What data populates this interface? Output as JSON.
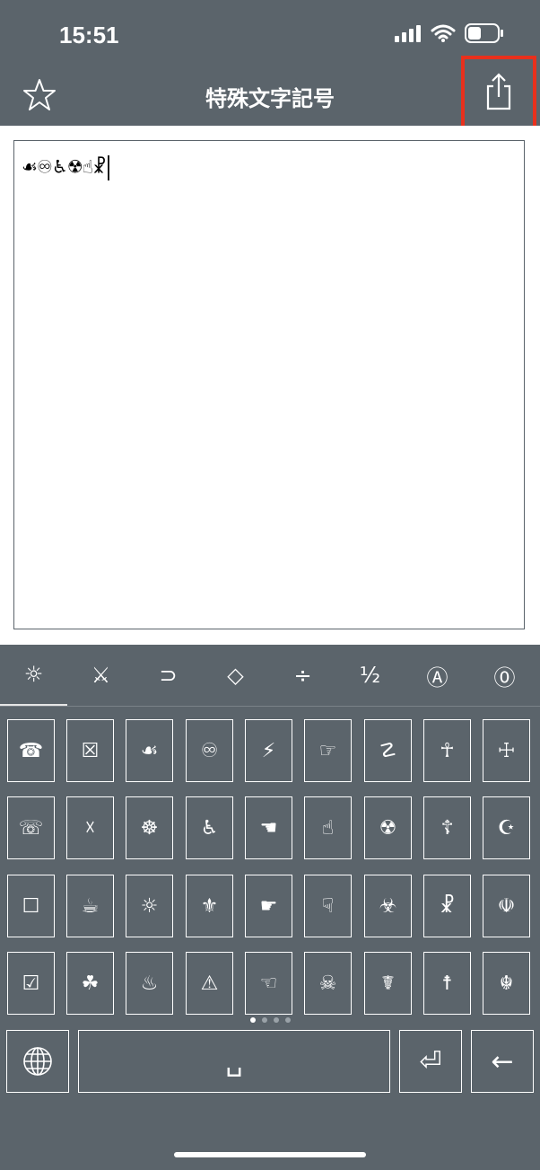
{
  "status_bar": {
    "time": "15:51"
  },
  "nav": {
    "title": "特殊文字記号",
    "star_icon": "star-outline-icon",
    "share_icon": "share-icon",
    "highlight_color": "#e8301c"
  },
  "editor": {
    "text": "☙♾♿☢☝☧"
  },
  "tabs": [
    {
      "symbol": "☼",
      "name": "tab-weather"
    },
    {
      "symbol": "⚔",
      "name": "tab-crossed-swords"
    },
    {
      "symbol": "⊃",
      "name": "tab-arrows"
    },
    {
      "symbol": "◇",
      "name": "tab-shapes"
    },
    {
      "symbol": "÷",
      "name": "tab-math"
    },
    {
      "symbol": "½",
      "name": "tab-fractions"
    },
    {
      "symbol": "Ⓐ",
      "name": "tab-circled-letters"
    },
    {
      "symbol": "⓪",
      "name": "tab-circled-numbers"
    }
  ],
  "keys": [
    [
      "☎",
      "☒",
      "☙",
      "♾",
      "⚡",
      "☞",
      "☡",
      "☥",
      "☩"
    ],
    [
      "☏",
      "☓",
      "☸",
      "♿",
      "☚",
      "☝",
      "☢",
      "☦",
      "☪"
    ],
    [
      "☐",
      "☕",
      "☼",
      "⚜",
      "☛",
      "☟",
      "☣",
      "☧",
      "☫"
    ],
    [
      "☑",
      "☘",
      "♨",
      "⚠",
      "☜",
      "☠",
      "☤",
      "☨",
      "☬"
    ]
  ],
  "page_indicator": {
    "total": 4,
    "current": 1
  },
  "bottom_keys": {
    "globe_icon": "globe-icon",
    "space": "␣",
    "return": "⏎",
    "backspace": "←"
  },
  "colors": {
    "background": "#5b646b",
    "editor": "#ffffff"
  }
}
